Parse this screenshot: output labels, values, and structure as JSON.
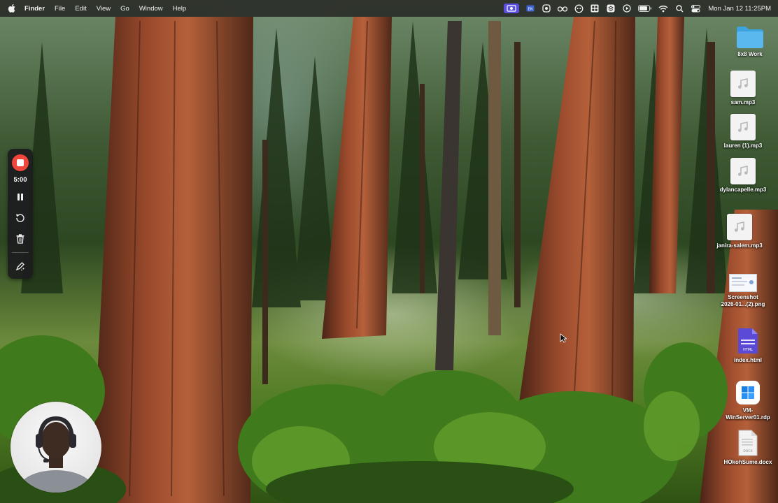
{
  "menubar": {
    "app_name": "Finder",
    "menus": [
      "File",
      "Edit",
      "View",
      "Go",
      "Window",
      "Help"
    ],
    "clock": "Mon Jan 12  11:25PM",
    "status_icons": [
      "screen-record-icon",
      "keyboard-layout-icon",
      "app-icon",
      "binoculars-icon",
      "copilot-icon",
      "grid-icon",
      "layers-icon",
      "play-circle-icon",
      "battery-icon",
      "wifi-icon",
      "search-icon",
      "control-center-icon"
    ],
    "highlight_color": "#5b4fe0"
  },
  "recorder": {
    "time": "5:00",
    "stop_color": "#f0453a",
    "buttons": [
      "stop-icon",
      "pause-icon",
      "restart-icon",
      "trash-icon",
      "draw-icon"
    ]
  },
  "desktop_icons": [
    {
      "label": "8x8 Work",
      "kind": "folder"
    },
    {
      "label": "sam.mp3",
      "kind": "audio"
    },
    {
      "label": "lauren (1).mp3",
      "kind": "audio"
    },
    {
      "label": "dylancapelle.mp3",
      "kind": "audio"
    },
    {
      "label": "janira-salem.mp3",
      "kind": "audio"
    },
    {
      "label_line1": "Screenshot",
      "label_line2": "2026-01...(2).png",
      "kind": "image"
    },
    {
      "label": "index.html",
      "kind": "html"
    },
    {
      "label_line1": "VM-",
      "label_line2": "WinServer01.rdp",
      "kind": "rdp"
    },
    {
      "label": "HOkohSume.docx",
      "kind": "docx"
    }
  ],
  "html_badge": "HTML",
  "docx_badge": "DOCX"
}
